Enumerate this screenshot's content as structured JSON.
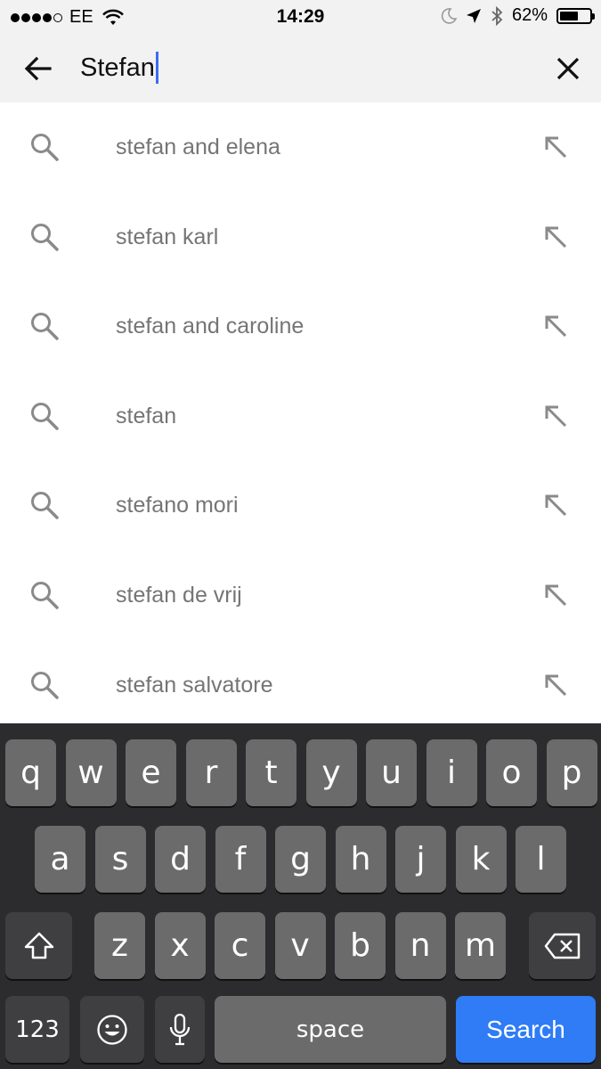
{
  "status_bar": {
    "carrier": "EE",
    "time": "14:29",
    "battery": "62%",
    "battery_level": 0.62
  },
  "search": {
    "query": "Stefan"
  },
  "suggestions": [
    {
      "text": "stefan and elena"
    },
    {
      "text": "stefan karl"
    },
    {
      "text": "stefan and caroline"
    },
    {
      "text": "stefan"
    },
    {
      "text": "stefano mori"
    },
    {
      "text": "stefan de vrij"
    },
    {
      "text": "stefan salvatore"
    }
  ],
  "keyboard": {
    "row1": [
      "q",
      "w",
      "e",
      "r",
      "t",
      "y",
      "u",
      "i",
      "o",
      "p"
    ],
    "row2": [
      "a",
      "s",
      "d",
      "f",
      "g",
      "h",
      "j",
      "k",
      "l"
    ],
    "row3": [
      "z",
      "x",
      "c",
      "v",
      "b",
      "n",
      "m"
    ],
    "numbers_label": "123",
    "space_label": "space",
    "search_label": "Search"
  },
  "colors": {
    "accent": "#2f7cf6",
    "caret": "#3a6df0",
    "suggestion_text": "#757575"
  }
}
